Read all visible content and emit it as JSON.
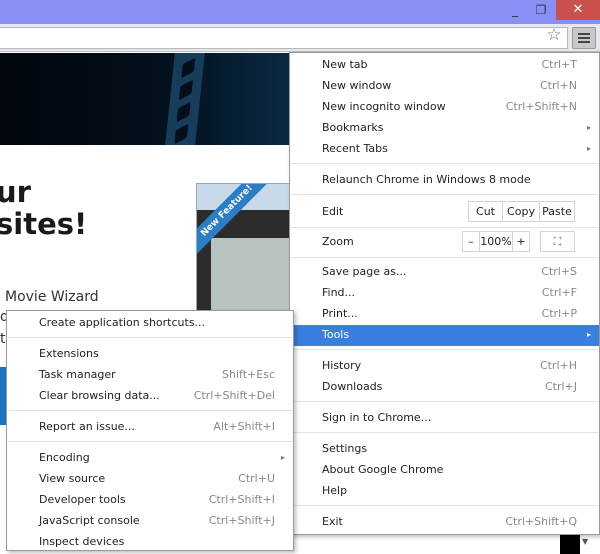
{
  "window": {
    "minimize_icon": "minimize-icon",
    "maximize_icon": "restore-icon",
    "close_icon": "close-icon",
    "minimize_glyph": "_",
    "restore_glyph": "❐",
    "close_glyph": "✕"
  },
  "toolbar": {
    "omnibox_value": "",
    "star_glyph": "☆",
    "menu_icon": "hamburger-icon"
  },
  "page": {
    "headline_line1": "ur",
    "headline_line2": "sites!",
    "subtitle": "Movie Wizard",
    "ribbon": "New Feature!",
    "thumb_url": "http://ww",
    "left_letters": [
      "d",
      "t"
    ]
  },
  "main_menu": {
    "items": [
      {
        "label": "New tab",
        "shortcut": "Ctrl+T"
      },
      {
        "label": "New window",
        "shortcut": "Ctrl+N"
      },
      {
        "label": "New incognito window",
        "shortcut": "Ctrl+Shift+N"
      },
      {
        "label": "Bookmarks",
        "submenu": true
      },
      {
        "label": "Recent Tabs",
        "submenu": true
      },
      {
        "label": "Relaunch Chrome in Windows 8 mode"
      },
      {
        "label": "Edit"
      },
      {
        "label": "Zoom"
      },
      {
        "label": "Save page as...",
        "shortcut": "Ctrl+S"
      },
      {
        "label": "Find...",
        "shortcut": "Ctrl+F"
      },
      {
        "label": "Print...",
        "shortcut": "Ctrl+P"
      },
      {
        "label": "Tools",
        "submenu": true,
        "highlighted": true
      },
      {
        "label": "History",
        "shortcut": "Ctrl+H"
      },
      {
        "label": "Downloads",
        "shortcut": "Ctrl+J"
      },
      {
        "label": "Sign in to Chrome..."
      },
      {
        "label": "Settings"
      },
      {
        "label": "About Google Chrome"
      },
      {
        "label": "Help"
      },
      {
        "label": "Exit",
        "shortcut": "Ctrl+Shift+Q"
      }
    ],
    "edit_buttons": {
      "cut": "Cut",
      "copy": "Copy",
      "paste": "Paste"
    },
    "zoom_controls": {
      "minus": "–",
      "level": "100%",
      "plus": "+",
      "fullscreen": "⛶"
    },
    "submenu_arrow": "▸"
  },
  "tools_submenu": {
    "items": [
      {
        "label": "Create application shortcuts..."
      },
      {
        "label": "Extensions"
      },
      {
        "label": "Task manager",
        "shortcut": "Shift+Esc"
      },
      {
        "label": "Clear browsing data...",
        "shortcut": "Ctrl+Shift+Del"
      },
      {
        "label": "Report an issue...",
        "shortcut": "Alt+Shift+I"
      },
      {
        "label": "Encoding",
        "submenu": true
      },
      {
        "label": "View source",
        "shortcut": "Ctrl+U"
      },
      {
        "label": "Developer tools",
        "shortcut": "Ctrl+Shift+I"
      },
      {
        "label": "JavaScript console",
        "shortcut": "Ctrl+Shift+J"
      },
      {
        "label": "Inspect devices"
      }
    ]
  },
  "colors": {
    "titlebar": "#8a8ff5",
    "close": "#c9504b",
    "highlight": "#3a7ee0"
  }
}
